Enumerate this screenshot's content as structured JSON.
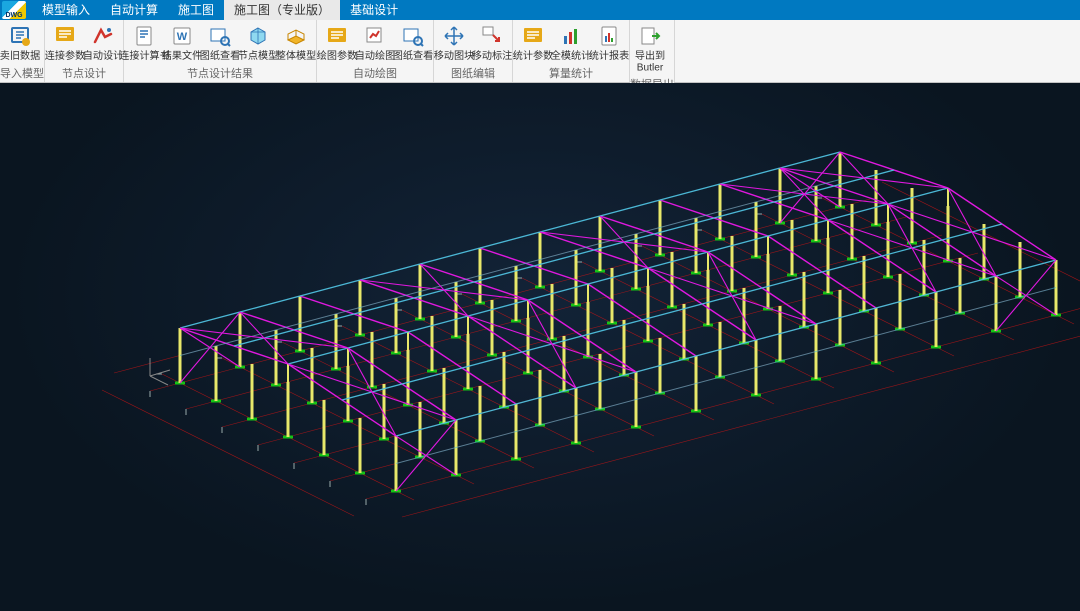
{
  "menubar": {
    "items": [
      {
        "label": "模型输入"
      },
      {
        "label": "自动计算"
      },
      {
        "label": "施工图"
      },
      {
        "label": "施工图（专业版）",
        "active": true
      },
      {
        "label": "基础设计"
      }
    ]
  },
  "ribbon": {
    "groups": [
      {
        "title": "导入模型",
        "buttons": [
          {
            "label": "卖旧数据",
            "icon": "import-data-icon"
          }
        ]
      },
      {
        "title": "节点设计",
        "buttons": [
          {
            "label": "连接参数",
            "icon": "link-params-icon"
          },
          {
            "label": "自动设计",
            "icon": "auto-design-icon"
          }
        ]
      },
      {
        "title": "节点设计结果",
        "buttons": [
          {
            "label": "连接计算书",
            "icon": "calc-sheet-icon"
          },
          {
            "label": "结果文件",
            "icon": "result-file-icon"
          },
          {
            "label": "图纸查看",
            "icon": "drawing-view-icon"
          },
          {
            "label": "节点模型",
            "icon": "node-model-icon"
          },
          {
            "label": "整体模型",
            "icon": "whole-model-icon"
          }
        ]
      },
      {
        "title": "自动绘图",
        "buttons": [
          {
            "label": "绘图参数",
            "icon": "draw-params-icon"
          },
          {
            "label": "自动绘图",
            "icon": "auto-draw-icon"
          },
          {
            "label": "图纸查看",
            "icon": "drawing-view2-icon"
          }
        ]
      },
      {
        "title": "图纸编辑",
        "buttons": [
          {
            "label": "移动图块",
            "icon": "move-block-icon"
          },
          {
            "label": "移动标注",
            "icon": "move-label-icon"
          }
        ]
      },
      {
        "title": "算量统计",
        "buttons": [
          {
            "label": "统计参数",
            "icon": "stat-params-icon"
          },
          {
            "label": "全模统计",
            "icon": "full-stat-icon"
          },
          {
            "label": "统计报表",
            "icon": "stat-report-icon"
          }
        ]
      },
      {
        "title": "数据导出",
        "buttons": [
          {
            "label": "导出到\nButler",
            "icon": "export-icon"
          }
        ]
      }
    ]
  },
  "colors": {
    "menubar_bg": "#0079c1",
    "ribbon_bg": "#f5f5f5",
    "viewport_bg": "#0b1624",
    "grid": "#d11414",
    "base": "#16c216",
    "column": "#e8e86a",
    "beam": "#7ed4f0",
    "brace": "#e018e0",
    "purlin": "#4fc0de"
  }
}
